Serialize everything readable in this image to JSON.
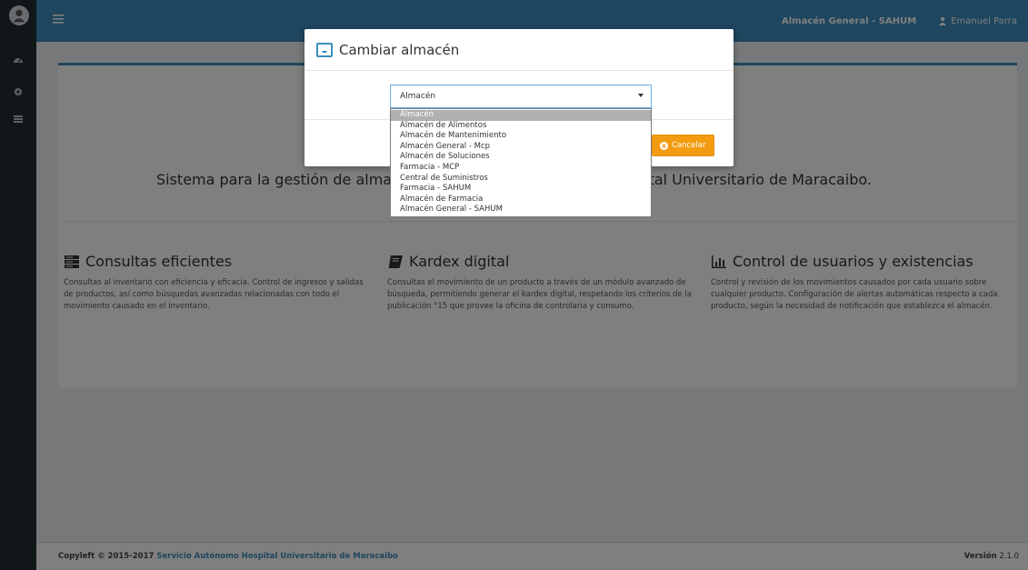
{
  "topbar": {
    "menu_icon": "hamburger-icon",
    "warehouse": "Almacén General - SAHUM",
    "user": "Emanuel Parra",
    "user_icon": "user-icon",
    "color": "#3c8dbc"
  },
  "sidebar": {
    "logo_icon": "avatar-logo",
    "items": [
      {
        "icon": "dashboard-icon"
      },
      {
        "icon": "gear-icon"
      },
      {
        "icon": "list-icon"
      }
    ]
  },
  "main": {
    "headline": "Sistema para la gestión de almacenes del Servicio Autónomo Hospital Universitario de Maracaibo.",
    "features": [
      {
        "icon": "server-icon",
        "title": "Consultas eficientes",
        "text": "Consultas al inventario con eficiencia y eficacia. Control de ingresos y salidas de productos, así como búsquedas avanzadas relacionadas con todo el movimiento causado en el inventario."
      },
      {
        "icon": "book-icon",
        "title": "Kardex digital",
        "text": "Consultas el movimiento de un producto a través de un módulo avanzado de búsqueda, permitiendo generar el kardex digital, respetando los criterios de la publicación °15 que provee la oficina de controlaria y consumo."
      },
      {
        "icon": "bar-chart-icon",
        "title": "Control de usuarios y existencias",
        "text": "Control y revisión de los movimientos causados por cada usuario sobre cualquier producto. Configuración de alertas automáticas respecto a cada producto, según la necesidad de notificación que establezca el almacén."
      }
    ]
  },
  "footer": {
    "copyleft": "Copyleft © 2015-2017",
    "org": "Servicio Autónomo Hospital Universitario de Maracaibo",
    "version_label": "Versión",
    "version": "2.1.0"
  },
  "modal": {
    "title": "Cambiar almacén",
    "icon": "inbox-icon",
    "select_value": "Almacén",
    "options": [
      "Almacén",
      "Almacén de Alimentos",
      "Almacén de Mantenimiento",
      "Almacén General - Mcp",
      "Almacén de Soluciones",
      "Farmacia - MCP",
      "Central de Suministros",
      "Farmacia - SAHUM",
      "Almacén de Farmacia",
      "Almacén General - SAHUM"
    ],
    "selected_index": 0,
    "cancel_label": "Cancelar",
    "cancel_color": "#f39c12"
  }
}
